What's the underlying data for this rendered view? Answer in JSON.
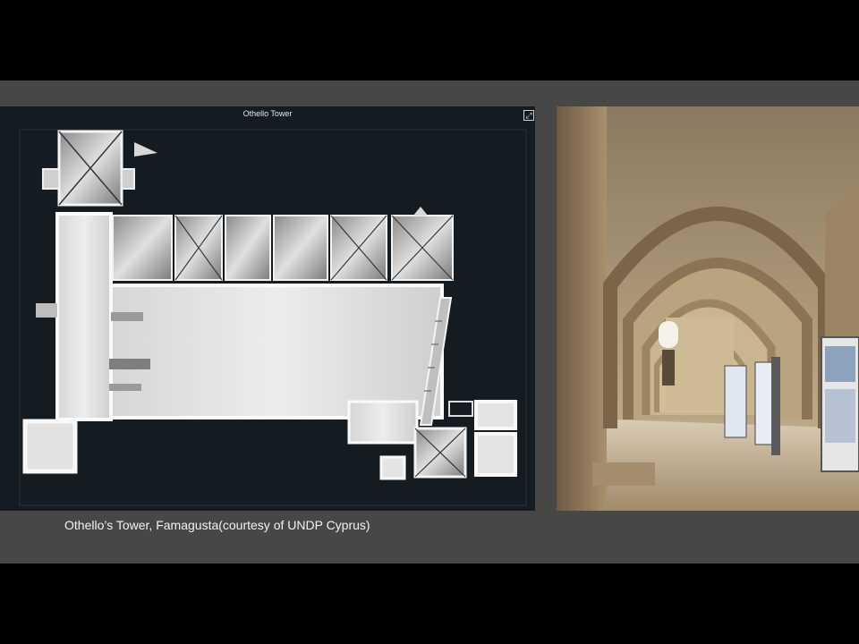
{
  "slide": {
    "caption": "Othello’s Tower, Famagusta(courtesy of UNDP Cyprus)"
  },
  "plan_viewer": {
    "title": "Othello Tower",
    "expand_icon": "expand-icon",
    "expand_glyph": "⤢"
  },
  "photo": {
    "subject": "interior-vaulted-hall"
  },
  "colors": {
    "background": "#000000",
    "band": "#474747",
    "plan_background": "#141b21",
    "caption_text": "#f2f2f2"
  }
}
